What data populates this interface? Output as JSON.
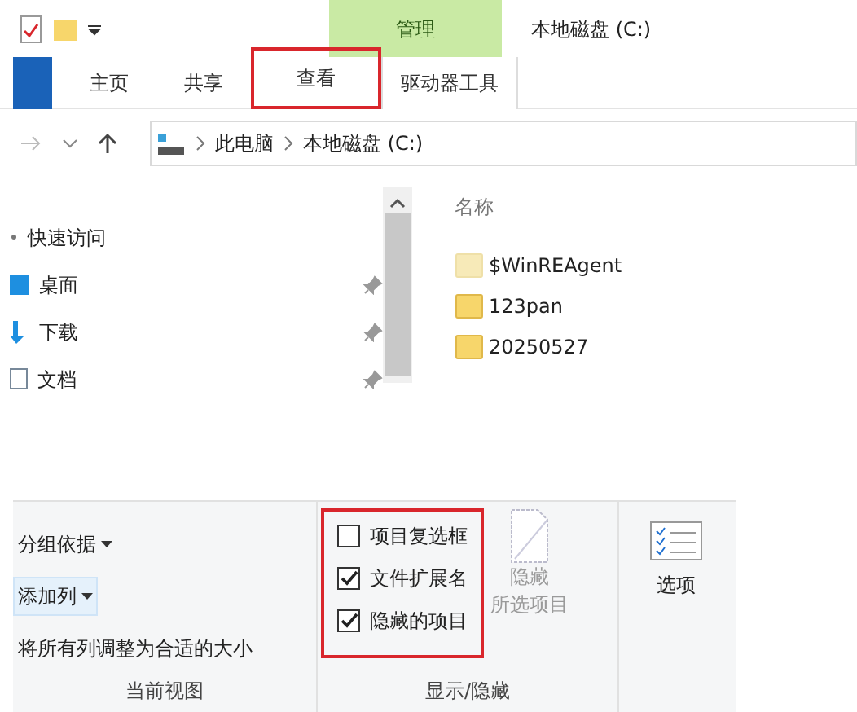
{
  "window": {
    "title": "本地磁盘 (C:)"
  },
  "contextual_tab": {
    "label": "管理"
  },
  "ribbon_tabs": [
    {
      "label": "主页",
      "kind": "tab",
      "highlighted": false
    },
    {
      "label": "共享",
      "kind": "tab",
      "highlighted": false
    },
    {
      "label": "查看",
      "kind": "tab",
      "highlighted": true
    },
    {
      "label": "驱动器工具",
      "kind": "contextual",
      "highlighted": false
    }
  ],
  "address_bar": {
    "crumbs": [
      "此电脑",
      "本地磁盘 (C:)"
    ]
  },
  "navigation_pane": {
    "items": [
      {
        "label": "快速访问",
        "kind": "header",
        "pinned": false
      },
      {
        "label": "桌面",
        "kind": "desktop",
        "pinned": true
      },
      {
        "label": "下载",
        "kind": "download",
        "pinned": true
      },
      {
        "label": "文档",
        "kind": "document",
        "pinned": true
      }
    ]
  },
  "file_list": {
    "columns": [
      "名称"
    ],
    "items": [
      {
        "name": "$WinREAgent",
        "hidden": true
      },
      {
        "name": "123pan",
        "hidden": false
      },
      {
        "name": "20250527",
        "hidden": false
      }
    ]
  },
  "view_ribbon": {
    "current_view": {
      "label": "当前视图",
      "commands": [
        {
          "label": "分组依据",
          "dropdown": true,
          "hover": false
        },
        {
          "label": "添加列",
          "dropdown": true,
          "hover": true
        },
        {
          "label": "将所有列调整为合适的大小",
          "dropdown": false,
          "hover": false
        }
      ]
    },
    "show_hide": {
      "label": "显示/隐藏",
      "highlighted": true,
      "checkboxes": [
        {
          "label": "项目复选框",
          "checked": false
        },
        {
          "label": "文件扩展名",
          "checked": true
        },
        {
          "label": "隐藏的项目",
          "checked": true
        }
      ],
      "hide_button": {
        "lines": [
          "隐藏",
          "所选项目"
        ],
        "disabled": true
      }
    },
    "options_button": {
      "label": "选项"
    }
  }
}
